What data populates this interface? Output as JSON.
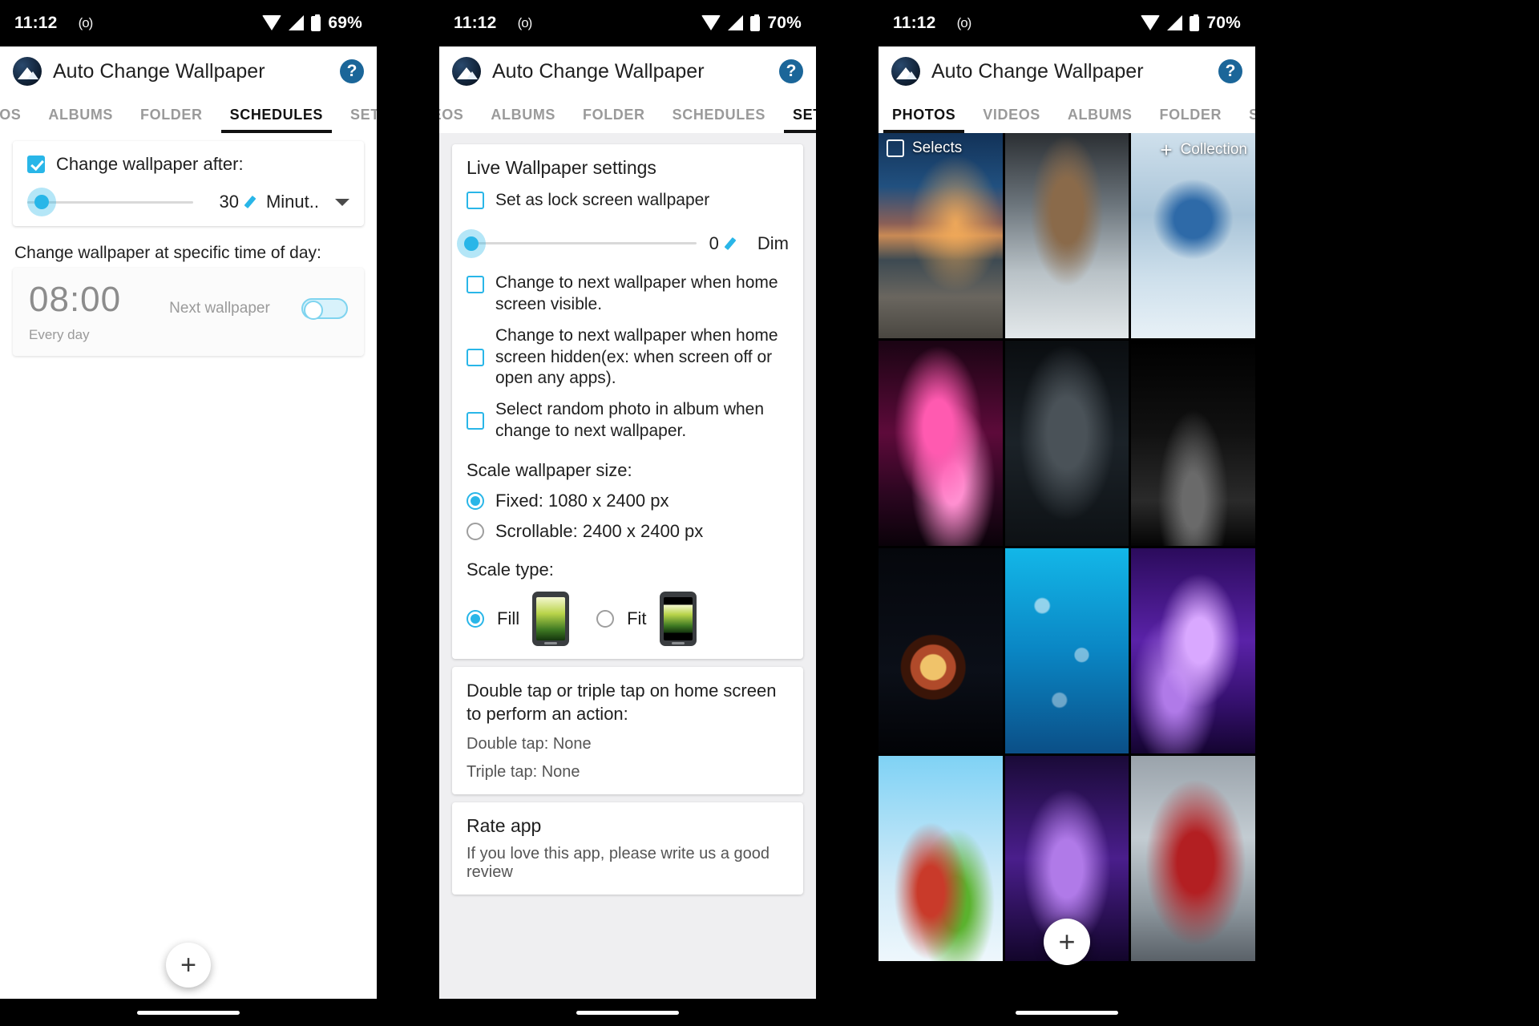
{
  "app": {
    "title": "Auto Change Wallpaper",
    "logo_icon": "mountain-logo-icon",
    "help_icon": "help-circle-icon"
  },
  "panel1": {
    "status": {
      "time": "11:12",
      "cast_icon": "(o)",
      "battery": "69%",
      "wifi_icon": "wifi-icon",
      "signal_icon": "signal-icon",
      "battery_icon": "battery-icon"
    },
    "tabs": [
      {
        "label": "DEOS",
        "active": false
      },
      {
        "label": "ALBUMS",
        "active": false
      },
      {
        "label": "FOLDER",
        "active": false
      },
      {
        "label": "SCHEDULES",
        "active": true
      },
      {
        "label": "SETTINGS",
        "active": false
      }
    ],
    "change_after": {
      "label": "Change wallpaper after:",
      "checked": true,
      "value": "30",
      "unit": "Minut..",
      "edit_icon": "pencil-icon",
      "dropdown_icon": "chevron-down-icon",
      "slider_percent": 8
    },
    "specific_time_label": "Change wallpaper at specific time of day:",
    "schedule": {
      "time": "08:00",
      "repeat": "Every day",
      "next": "Next wallpaper",
      "enabled": false
    },
    "fab_label": "+"
  },
  "panel2": {
    "status": {
      "time": "11:12",
      "cast_icon": "(o)",
      "battery": "70%"
    },
    "tabs": [
      {
        "label": "DEOS",
        "active": false
      },
      {
        "label": "ALBUMS",
        "active": false
      },
      {
        "label": "FOLDER",
        "active": false
      },
      {
        "label": "SCHEDULES",
        "active": false
      },
      {
        "label": "SETTINGS",
        "active": true
      }
    ],
    "live_wallpaper": {
      "heading": "Live Wallpaper settings",
      "lock_screen": {
        "label": "Set as lock screen wallpaper",
        "checked": false
      },
      "dim": {
        "value": "0",
        "label": "Dim",
        "edit_icon": "pencil-icon",
        "slider_percent": 0
      },
      "home_visible": {
        "label": "Change to next wallpaper when home screen visible.",
        "checked": false
      },
      "home_hidden": {
        "label": "Change to next wallpaper when home screen hidden(ex: when screen off or open any apps).",
        "checked": false
      },
      "random_photo": {
        "label": "Select random photo in album when change to next wallpaper.",
        "checked": false
      },
      "scale_size_heading": "Scale wallpaper size:",
      "scale_size_options": [
        {
          "label": "Fixed: 1080 x 2400 px",
          "selected": true
        },
        {
          "label": "Scrollable: 2400 x 2400 px",
          "selected": false
        }
      ],
      "scale_type_heading": "Scale type:",
      "scale_type_options": [
        {
          "label": "Fill",
          "selected": true,
          "icon": "phone-fill-preview-icon"
        },
        {
          "label": "Fit",
          "selected": false,
          "icon": "phone-fit-preview-icon"
        }
      ]
    },
    "tap_card": {
      "heading": "Double tap or triple tap on home screen to perform an action:",
      "double_tap": "Double tap: None",
      "triple_tap": "Triple tap: None"
    },
    "rate_card": {
      "heading": "Rate app",
      "body": "If you love this app, please write us a good review"
    }
  },
  "panel3": {
    "status": {
      "time": "11:12",
      "cast_icon": "(o)",
      "battery": "70%"
    },
    "tabs": [
      {
        "label": "PHOTOS",
        "active": true
      },
      {
        "label": "VIDEOS",
        "active": false
      },
      {
        "label": "ALBUMS",
        "active": false
      },
      {
        "label": "FOLDER",
        "active": false
      },
      {
        "label": "SCHEDULES",
        "active": false
      }
    ],
    "selects_badge": "Selects",
    "collection_badge": "Collection",
    "add_icon": "plus-icon",
    "fab_label": "+",
    "thumbnails": [
      {
        "name": "sunset-rocks-beach",
        "class": "w-sunset"
      },
      {
        "name": "deer-in-snow",
        "class": "w-deer"
      },
      {
        "name": "snowman-winter",
        "class": "w-snow"
      },
      {
        "name": "pink-butterflies",
        "class": "w-butterfly"
      },
      {
        "name": "spiderman-rain",
        "class": "w-spider"
      },
      {
        "name": "eiffel-tower-night",
        "class": "w-eiffel"
      },
      {
        "name": "planet-space",
        "class": "w-planet"
      },
      {
        "name": "water-droplets-blue",
        "class": "w-drops"
      },
      {
        "name": "purple-butterflies",
        "class": "w-purple"
      },
      {
        "name": "red-green-leaves",
        "class": "w-leaf"
      },
      {
        "name": "violet-abstract",
        "class": "w-violet"
      },
      {
        "name": "red-hooded-figure",
        "class": "w-red"
      }
    ]
  },
  "colors": {
    "accent": "#29b6e8",
    "help_blue": "#1b6699",
    "tab_active": "#111111",
    "tab_inactive": "#9a9a9a"
  }
}
